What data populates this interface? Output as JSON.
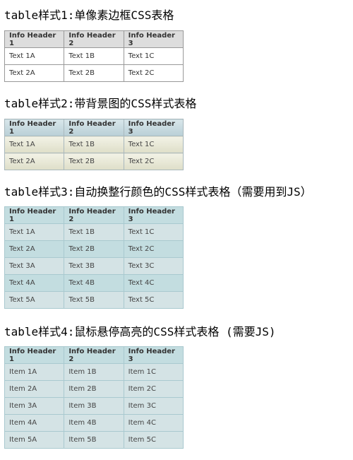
{
  "sections": [
    {
      "title": "table样式1:单像素边框CSS表格",
      "headers": [
        "Info Header 1",
        "Info Header 2",
        "Info Header 3"
      ],
      "rows": [
        [
          "Text 1A",
          "Text 1B",
          "Text 1C"
        ],
        [
          "Text 2A",
          "Text 2B",
          "Text 2C"
        ]
      ]
    },
    {
      "title": "table样式2:带背景图的CSS样式表格",
      "headers": [
        "Info Header 1",
        "Info Header 2",
        "Info Header 3"
      ],
      "rows": [
        [
          "Text 1A",
          "Text 1B",
          "Text 1C"
        ],
        [
          "Text 2A",
          "Text 2B",
          "Text 2C"
        ]
      ]
    },
    {
      "title": "table样式3:自动换整行颜色的CSS样式表格（需要用到JS）",
      "headers": [
        "Info Header 1",
        "Info Header 2",
        "Info Header 3"
      ],
      "rows": [
        [
          "Text 1A",
          "Text 1B",
          "Text 1C"
        ],
        [
          "Text 2A",
          "Text 2B",
          "Text 2C"
        ],
        [
          "Text 3A",
          "Text 3B",
          "Text 3C"
        ],
        [
          "Text 4A",
          "Text 4B",
          "Text 4C"
        ],
        [
          "Text 5A",
          "Text 5B",
          "Text 5C"
        ]
      ]
    },
    {
      "title": "table样式4:鼠标悬停高亮的CSS样式表格 (需要JS)",
      "headers": [
        "Info Header 1",
        "Info Header 2",
        "Info Header 3"
      ],
      "rows": [
        [
          "Item 1A",
          "Item 1B",
          "Item 1C"
        ],
        [
          "Item 2A",
          "Item 2B",
          "Item 2C"
        ],
        [
          "Item 3A",
          "Item 3B",
          "Item 3C"
        ],
        [
          "Item 4A",
          "Item 4B",
          "Item 4C"
        ],
        [
          "Item 5A",
          "Item 5B",
          "Item 5C"
        ]
      ]
    }
  ]
}
